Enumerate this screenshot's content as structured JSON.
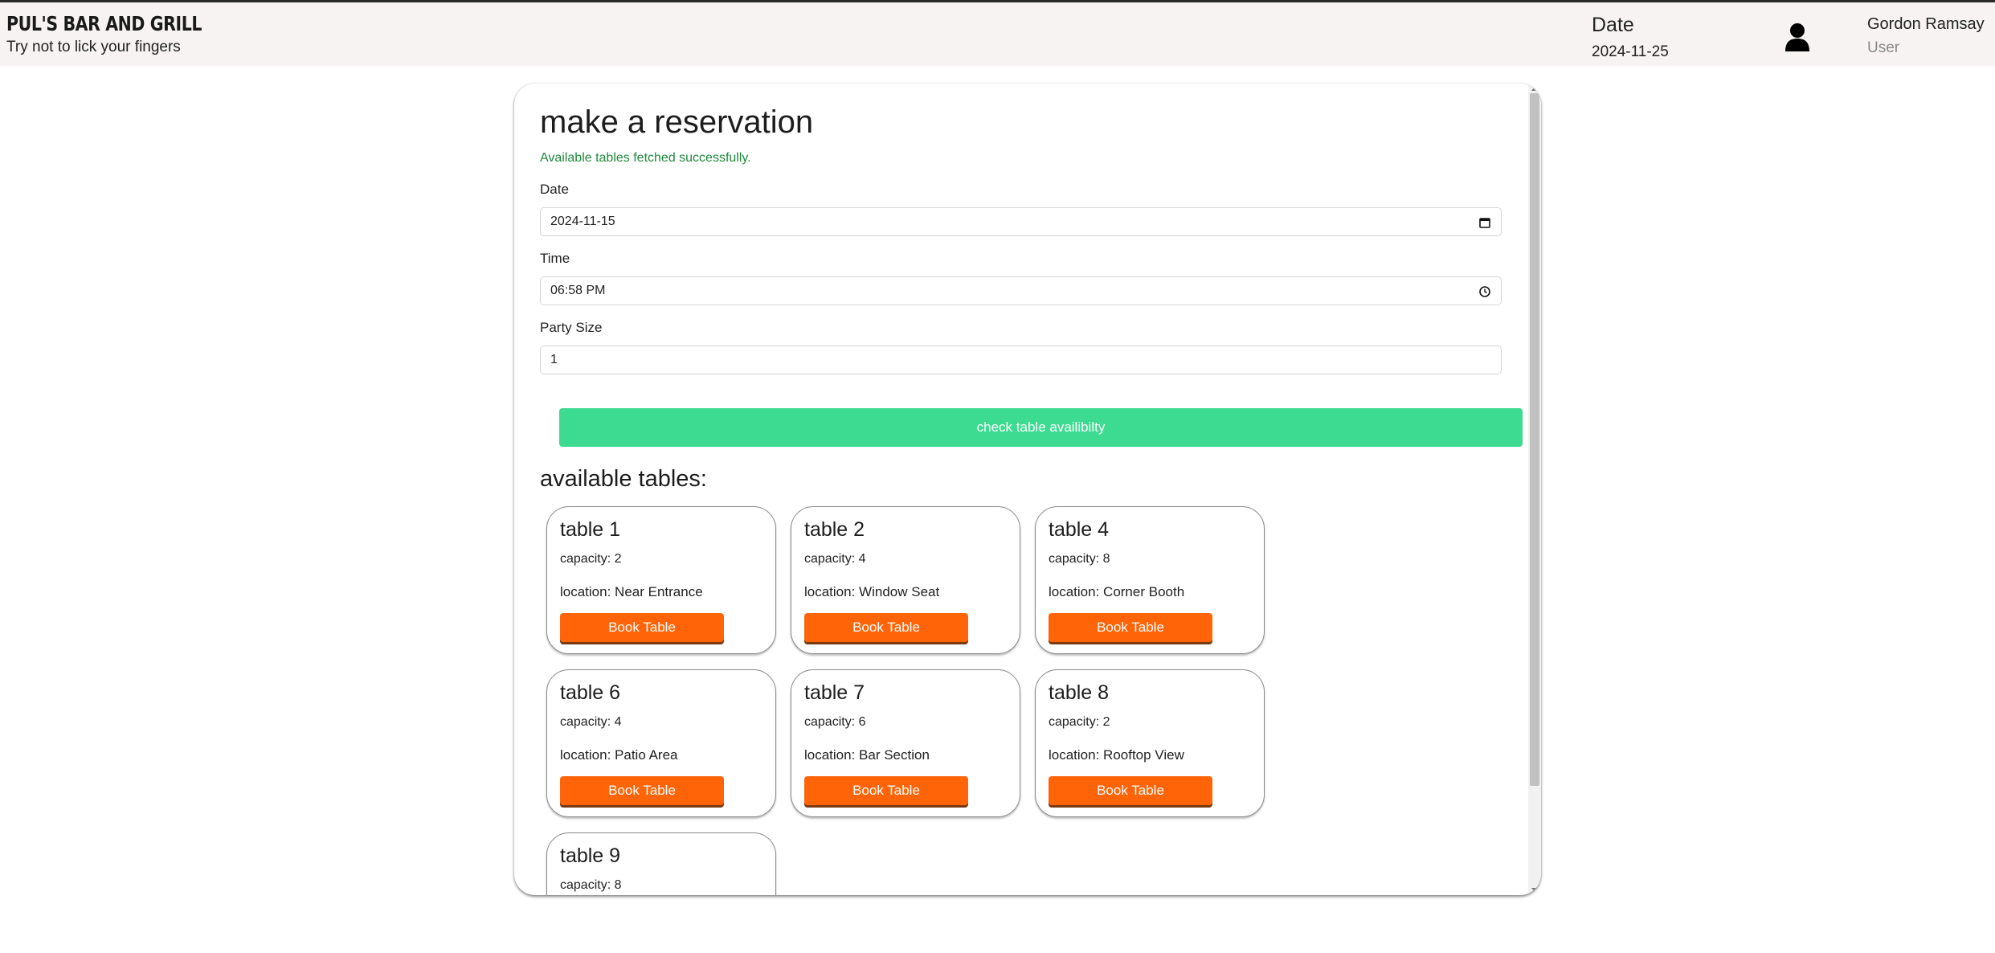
{
  "header": {
    "brand_name": "PUL'S BAR AND GRILL",
    "tagline": "Try not to lick your fingers",
    "date_label": "Date",
    "date_value": "2024-11-25",
    "avatar_icon": "user-icon",
    "user_name": "Gordon Ramsay",
    "user_role": "User"
  },
  "form": {
    "title": "make a reservation",
    "status_message": "Available tables fetched successfully.",
    "date_label": "Date",
    "date_value": "2024-11-15",
    "date_icon": "calendar-icon",
    "time_label": "Time",
    "time_value": "06:58 PM",
    "time_icon": "clock-icon",
    "party_label": "Party Size",
    "party_value": "1",
    "check_button": "check table availibilty"
  },
  "tables_section": {
    "title": "available tables:",
    "book_label": "Book Table",
    "capacity_prefix": "capacity: ",
    "location_prefix": "location: ",
    "tables": [
      {
        "name": "table 1",
        "capacity": "capacity: 2",
        "location": "location: Near Entrance"
      },
      {
        "name": "table 2",
        "capacity": "capacity: 4",
        "location": "location: Window Seat"
      },
      {
        "name": "table 4",
        "capacity": "capacity: 8",
        "location": "location: Corner Booth"
      },
      {
        "name": "table 6",
        "capacity": "capacity: 4",
        "location": "location: Patio Area"
      },
      {
        "name": "table 7",
        "capacity": "capacity: 6",
        "location": "location: Bar Section"
      },
      {
        "name": "table 8",
        "capacity": "capacity: 2",
        "location": "location: Rooftop View"
      },
      {
        "name": "table 9",
        "capacity": "capacity: 8",
        "location": ""
      }
    ]
  },
  "colors": {
    "accent_green": "#3ddb92",
    "book_orange": "#ff6409",
    "success_text": "#1e8a3c",
    "header_bg": "#f6f3f2"
  }
}
